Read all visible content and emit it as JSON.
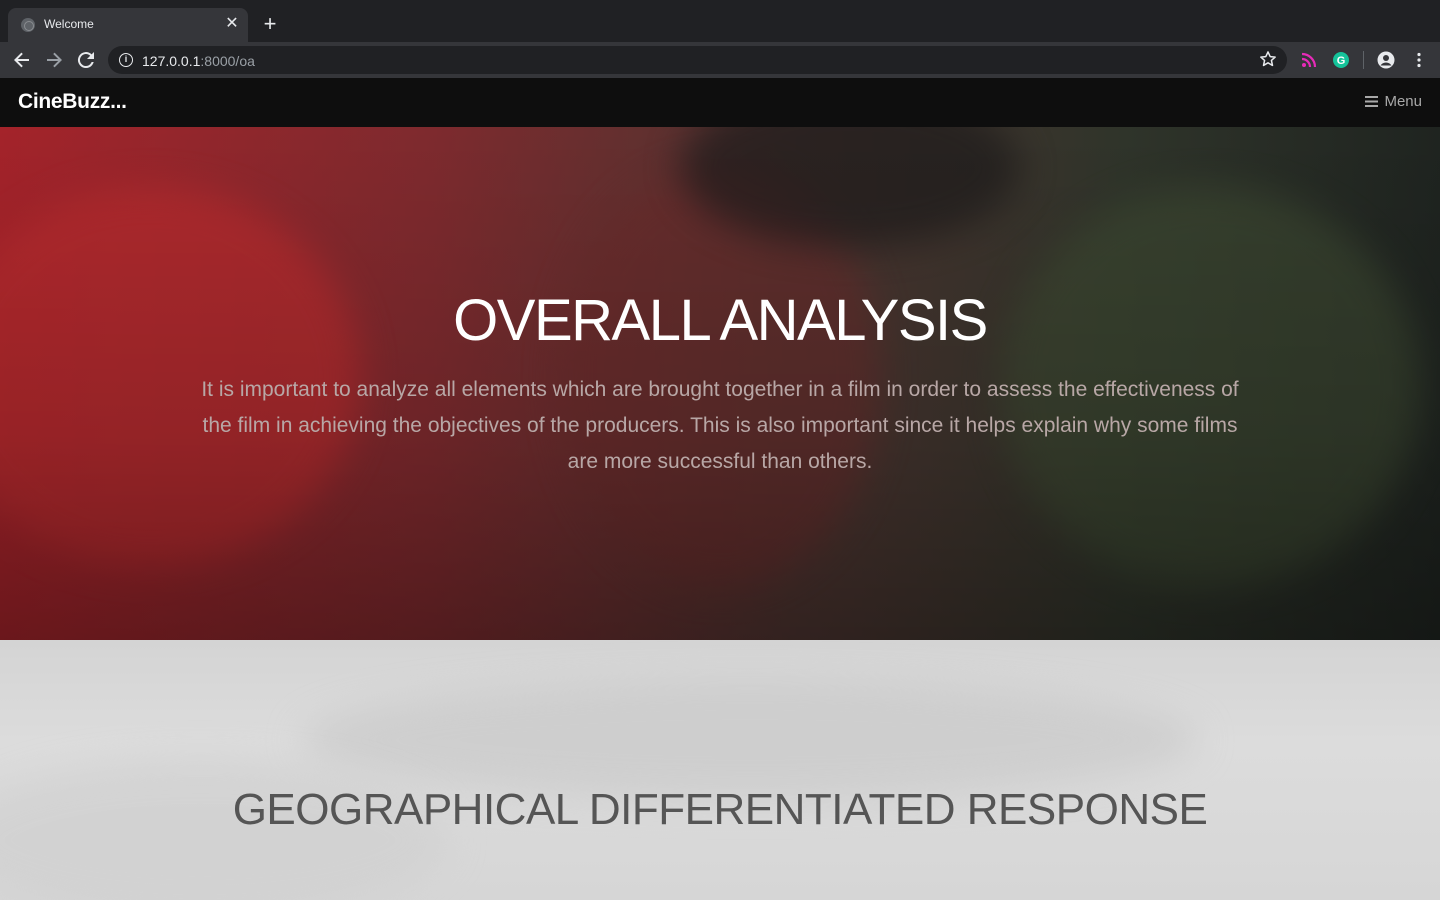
{
  "browser": {
    "tab_title": "Welcome",
    "url_host": "127.0.0.1",
    "url_path": ":8000/oa"
  },
  "navbar": {
    "brand": "CineBuzz...",
    "menu_label": "Menu"
  },
  "hero": {
    "title": "OVERALL ANALYSIS",
    "text": "It is important to analyze all elements which are brought together in a film in order to assess the effectiveness of the film in achieving the objectives of the producers. This is also important since it helps explain why some films are more successful than others."
  },
  "section2": {
    "title": "GEOGRAPHICAL DIFFERENTIATED RESPONSE"
  },
  "icons": [
    "globe-icon",
    "close-icon",
    "plus-icon",
    "back-arrow-icon",
    "forward-arrow-icon",
    "reload-icon",
    "info-icon",
    "star-icon",
    "rss-extension-icon",
    "grammarly-extension-icon",
    "profile-icon",
    "more-vertical-icon",
    "menu-bars-icon"
  ],
  "colors": {
    "navbar_bg": "#0e0e0e",
    "hero_accent": "#a4232a",
    "section2_bg": "#d9d9d9"
  }
}
